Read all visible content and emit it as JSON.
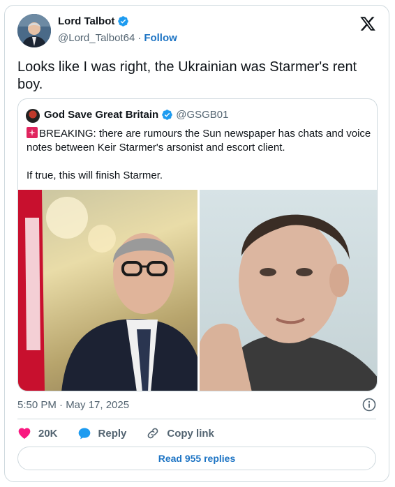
{
  "author": {
    "display_name": "Lord Talbot",
    "handle": "@Lord_Talbot64",
    "separator": "·",
    "follow_label": "Follow",
    "verified": true
  },
  "tweet_text": "Looks like I was right, the Ukrainian was Starmer's rent boy.",
  "quoted": {
    "display_name": "God Save Great Britain",
    "handle": "@GSGB01",
    "verified": true,
    "text_line1": "BREAKING: there are rumours the Sun newspaper has chats and voice notes between Keir Starmer's arsonist and escort client.",
    "text_line2": "If true, this will finish Starmer.",
    "emoji_icon": "siren-icon"
  },
  "timestamp": "5:50 PM · May 17, 2025",
  "actions": {
    "like_count": "20K",
    "reply_label": "Reply",
    "copy_label": "Copy link"
  },
  "read_replies_label": "Read 955 replies",
  "colors": {
    "accent": "#1d74c4",
    "verified": "#1d9bf0",
    "like": "#f91880",
    "muted": "#536471",
    "border": "#cfd9de"
  }
}
